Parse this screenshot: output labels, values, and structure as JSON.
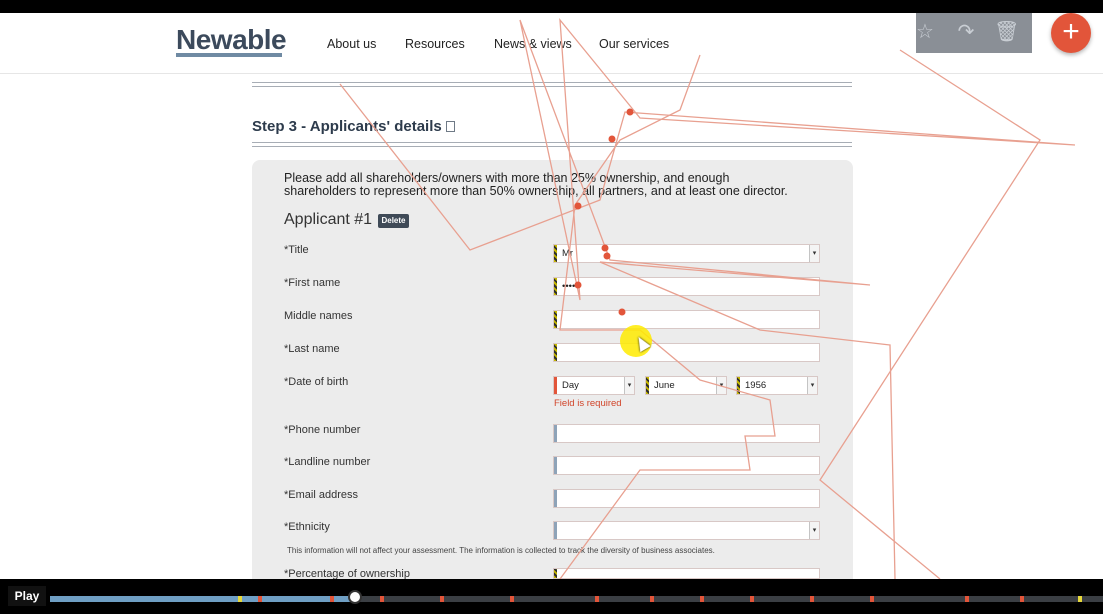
{
  "nav": {
    "logo": "Newable",
    "links": [
      "About us",
      "Resources",
      "News & views",
      "Our services"
    ],
    "tools": [
      "star-icon",
      "share-icon",
      "trash-icon"
    ],
    "fab": "+"
  },
  "step": {
    "title": "Step 3 - Applicants' details"
  },
  "form": {
    "intro": "Please add all shareholders/owners with more than 25% ownership, and enough shareholders to represent more than 50% ownership, all partners, and at least one director.",
    "applicant_heading": "Applicant #1",
    "delete_label": "Delete",
    "fields": {
      "title": {
        "label": "*Title",
        "value": "Mr"
      },
      "first_name": {
        "label": "*First name",
        "value": "•••••"
      },
      "middle_names": {
        "label": "Middle names",
        "value": ""
      },
      "last_name": {
        "label": "*Last name",
        "value": ""
      },
      "dob": {
        "label": "*Date of birth",
        "day": "Day",
        "month": "June",
        "year": "1956",
        "error": "Field is required"
      },
      "phone": {
        "label": "*Phone number",
        "value": ""
      },
      "landline": {
        "label": "*Landline number",
        "value": ""
      },
      "email": {
        "label": "*Email address",
        "value": ""
      },
      "ethnicity": {
        "label": "*Ethnicity",
        "value": "",
        "note": "This information will not affect your assessment. The information is collected to track the diversity of business associates."
      },
      "ownership": {
        "label": "*Percentage of ownership",
        "value": ""
      }
    }
  },
  "player": {
    "play_label": "Play",
    "progress": 0.29
  },
  "colors": {
    "accent": "#e2553a",
    "brand": "#3c4a5c",
    "panel": "#ececec"
  }
}
